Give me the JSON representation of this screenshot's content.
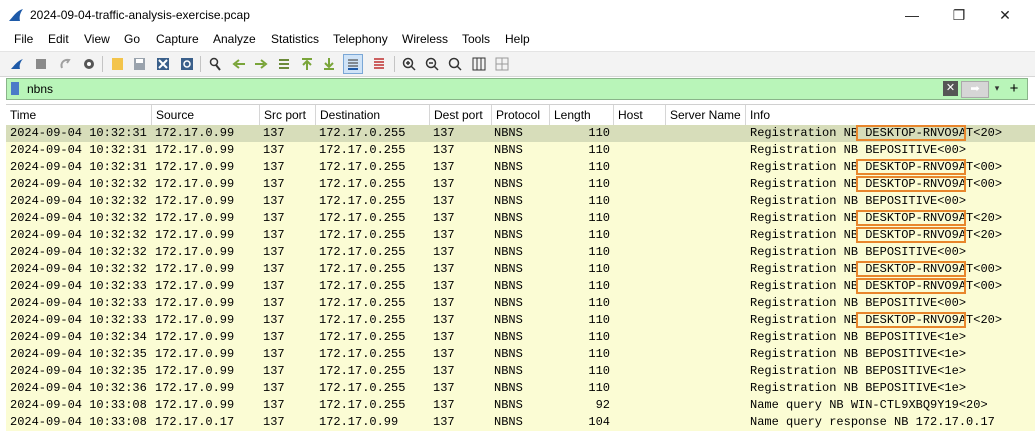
{
  "window": {
    "title": "2024-09-04-traffic-analysis-exercise.pcap",
    "min": "—",
    "max": "❐",
    "close": "✕"
  },
  "menu": [
    "File",
    "Edit",
    "View",
    "Go",
    "Capture",
    "Analyze",
    "Statistics",
    "Telephony",
    "Wireless",
    "Tools",
    "Help"
  ],
  "toolbar_icons": [
    "shark-fin-icon",
    "stop-icon",
    "restart-icon",
    "options-gear-icon",
    "open-folder-icon",
    "save-icon",
    "close-file-icon",
    "reload-icon",
    "find-icon",
    "back-arrow-icon",
    "forward-arrow-icon",
    "go-to-packet-icon",
    "first-packet-icon",
    "last-packet-icon",
    "autoscroll-icon",
    "colorize-icon",
    "zoom-in-icon",
    "zoom-out-icon",
    "normal-size-icon",
    "resize-columns-icon",
    "layout-icon"
  ],
  "filter": {
    "value": "nbns",
    "clear": "✕",
    "apply": "➡",
    "dropdown": "▾",
    "add": "+"
  },
  "columns": [
    "Time",
    "Source",
    "Src port",
    "Destination",
    "Dest port",
    "Protocol",
    "Length",
    "Host",
    "Server Name",
    "Info"
  ],
  "rows": [
    [
      "2024-09-04 10:32:31",
      "172.17.0.99",
      "137",
      "172.17.0.255",
      "137",
      "NBNS",
      "110",
      "",
      "",
      "Registration NB ",
      "DESKTOP-RNVO9AT",
      "<20>"
    ],
    [
      "2024-09-04 10:32:31",
      "172.17.0.99",
      "137",
      "172.17.0.255",
      "137",
      "NBNS",
      "110",
      "",
      "",
      "Registration NB ",
      "BEPOSITIVE",
      "<00>"
    ],
    [
      "2024-09-04 10:32:31",
      "172.17.0.99",
      "137",
      "172.17.0.255",
      "137",
      "NBNS",
      "110",
      "",
      "",
      "Registration NB ",
      "DESKTOP-RNVO9AT",
      "<00>"
    ],
    [
      "2024-09-04 10:32:32",
      "172.17.0.99",
      "137",
      "172.17.0.255",
      "137",
      "NBNS",
      "110",
      "",
      "",
      "Registration NB ",
      "DESKTOP-RNVO9AT",
      "<00>"
    ],
    [
      "2024-09-04 10:32:32",
      "172.17.0.99",
      "137",
      "172.17.0.255",
      "137",
      "NBNS",
      "110",
      "",
      "",
      "Registration NB ",
      "BEPOSITIVE",
      "<00>"
    ],
    [
      "2024-09-04 10:32:32",
      "172.17.0.99",
      "137",
      "172.17.0.255",
      "137",
      "NBNS",
      "110",
      "",
      "",
      "Registration NB ",
      "DESKTOP-RNVO9AT",
      "<20>"
    ],
    [
      "2024-09-04 10:32:32",
      "172.17.0.99",
      "137",
      "172.17.0.255",
      "137",
      "NBNS",
      "110",
      "",
      "",
      "Registration NB ",
      "DESKTOP-RNVO9AT",
      "<20>"
    ],
    [
      "2024-09-04 10:32:32",
      "172.17.0.99",
      "137",
      "172.17.0.255",
      "137",
      "NBNS",
      "110",
      "",
      "",
      "Registration NB ",
      "BEPOSITIVE",
      "<00>"
    ],
    [
      "2024-09-04 10:32:32",
      "172.17.0.99",
      "137",
      "172.17.0.255",
      "137",
      "NBNS",
      "110",
      "",
      "",
      "Registration NB ",
      "DESKTOP-RNVO9AT",
      "<00>"
    ],
    [
      "2024-09-04 10:32:33",
      "172.17.0.99",
      "137",
      "172.17.0.255",
      "137",
      "NBNS",
      "110",
      "",
      "",
      "Registration NB ",
      "DESKTOP-RNVO9AT",
      "<00>"
    ],
    [
      "2024-09-04 10:32:33",
      "172.17.0.99",
      "137",
      "172.17.0.255",
      "137",
      "NBNS",
      "110",
      "",
      "",
      "Registration NB ",
      "BEPOSITIVE",
      "<00>"
    ],
    [
      "2024-09-04 10:32:33",
      "172.17.0.99",
      "137",
      "172.17.0.255",
      "137",
      "NBNS",
      "110",
      "",
      "",
      "Registration NB ",
      "DESKTOP-RNVO9AT",
      "<20>"
    ],
    [
      "2024-09-04 10:32:34",
      "172.17.0.99",
      "137",
      "172.17.0.255",
      "137",
      "NBNS",
      "110",
      "",
      "",
      "Registration NB ",
      "BEPOSITIVE",
      "<1e>"
    ],
    [
      "2024-09-04 10:32:35",
      "172.17.0.99",
      "137",
      "172.17.0.255",
      "137",
      "NBNS",
      "110",
      "",
      "",
      "Registration NB ",
      "BEPOSITIVE",
      "<1e>"
    ],
    [
      "2024-09-04 10:32:35",
      "172.17.0.99",
      "137",
      "172.17.0.255",
      "137",
      "NBNS",
      "110",
      "",
      "",
      "Registration NB ",
      "BEPOSITIVE",
      "<1e>"
    ],
    [
      "2024-09-04 10:32:36",
      "172.17.0.99",
      "137",
      "172.17.0.255",
      "137",
      "NBNS",
      "110",
      "",
      "",
      "Registration NB ",
      "BEPOSITIVE",
      "<1e>"
    ],
    [
      "2024-09-04 10:33:08",
      "172.17.0.99",
      "137",
      "172.17.0.255",
      "137",
      "NBNS",
      "92",
      "",
      "",
      "Name query NB ",
      "WIN-CTL9XBQ9Y19",
      "<20>"
    ],
    [
      "2024-09-04 10:33:08",
      "172.17.0.17",
      "137",
      "172.17.0.99",
      "137",
      "NBNS",
      "104",
      "",
      "",
      "Name query response NB ",
      "172.17.0.17",
      ""
    ]
  ],
  "selected_row": 0,
  "highlight_rows": [
    0,
    2,
    3,
    5,
    6,
    8,
    9,
    11
  ],
  "colors": {
    "row_bg": "#fbfcd4",
    "selected_bg": "#d7ddba",
    "filter_bg": "#b9f5b9",
    "highlight": "#e8862c"
  }
}
